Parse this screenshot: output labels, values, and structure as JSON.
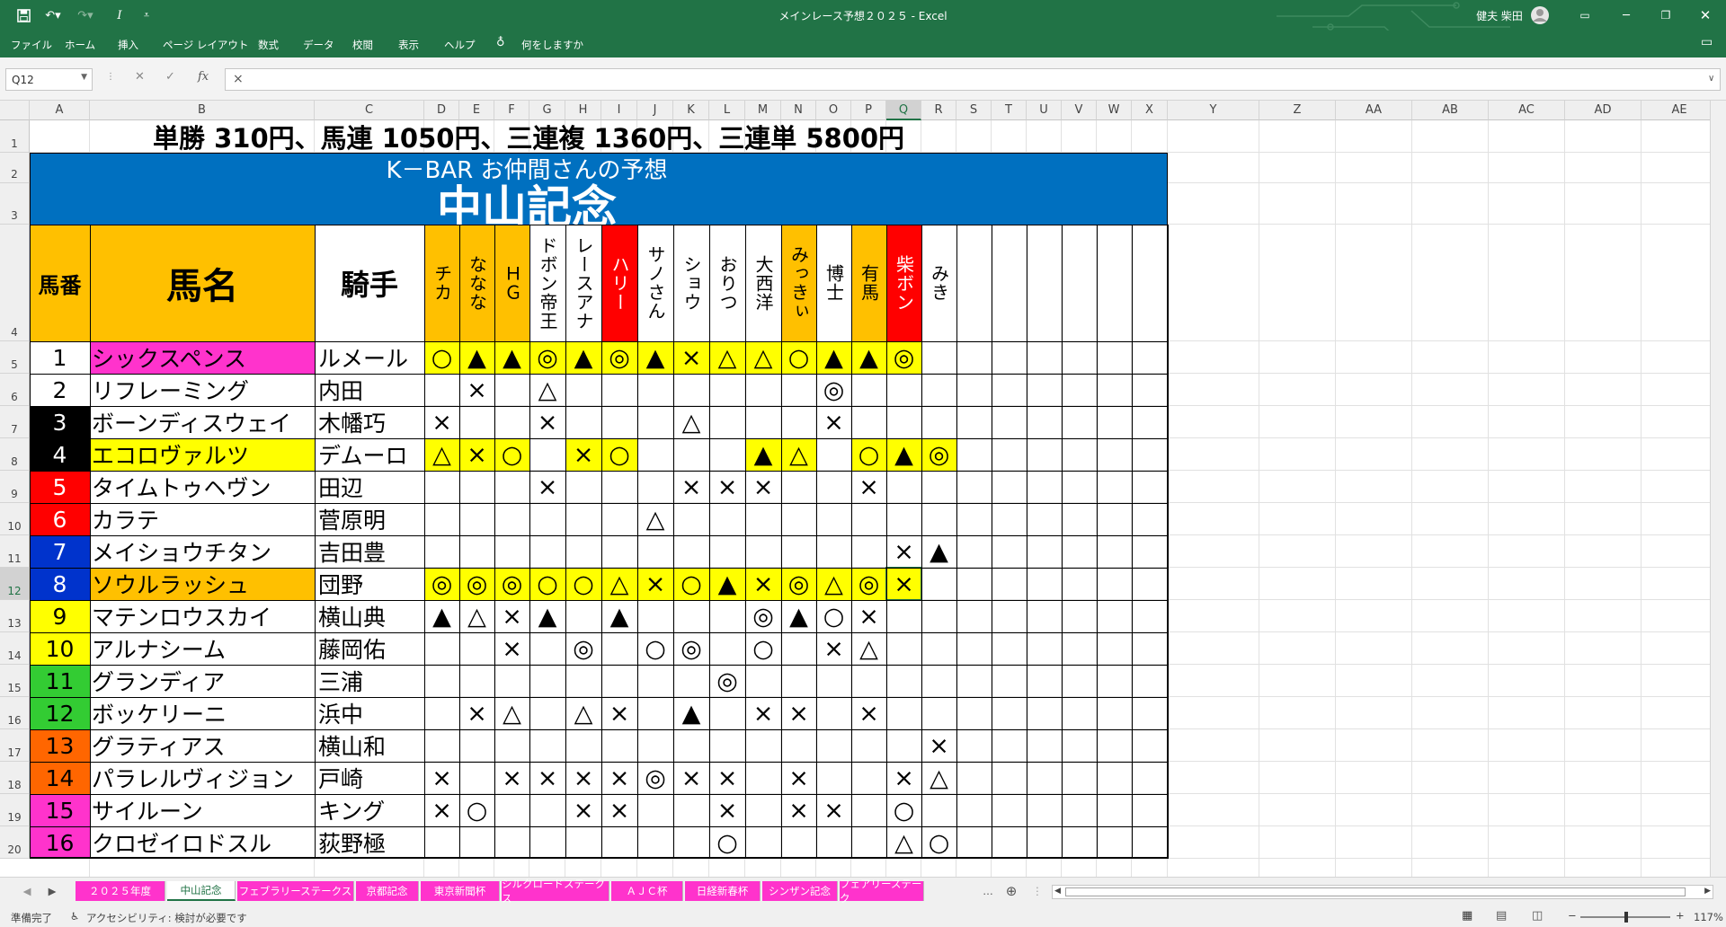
{
  "window": {
    "title": "メインレース予想２０２５ - Excel",
    "user": "健夫 柴田"
  },
  "ribbon": {
    "tabs": [
      "ファイル",
      "ホーム",
      "挿入",
      "ページ レイアウト",
      "数式",
      "データ",
      "校閲",
      "表示",
      "ヘルプ"
    ],
    "tell_me": "何をしますか"
  },
  "formula_bar": {
    "name_box": "Q12",
    "fx": "fx",
    "content": "×"
  },
  "columns": [
    "A",
    "B",
    "C",
    "D",
    "E",
    "F",
    "G",
    "H",
    "I",
    "J",
    "K",
    "L",
    "M",
    "N",
    "O",
    "P",
    "Q",
    "R",
    "S",
    "T",
    "U",
    "V",
    "W",
    "X",
    "Y",
    "Z",
    "AA",
    "AB",
    "AC",
    "AD",
    "AE"
  ],
  "selected_column": "Q",
  "selected_row": "12",
  "rows": [
    "1",
    "2",
    "3",
    "4",
    "5",
    "6",
    "7",
    "8",
    "9",
    "10",
    "11",
    "12",
    "13",
    "14",
    "15",
    "16",
    "17",
    "18",
    "19",
    "20"
  ],
  "sheet": {
    "payout": "単勝 310円、馬連 1050円、三連複 1360円、三連単 5800円",
    "subtitle": "K－BAR お仲間さんの予想",
    "race": "中山記念",
    "hdr_num": "馬番",
    "hdr_name": "馬名",
    "hdr_jockey": "騎手",
    "predictors": [
      "チカ",
      "ななな",
      "ＨＧ",
      "ドボン帝王",
      "レースアナ",
      "ハリー",
      "サノさん",
      "ショウ",
      "おりつ",
      "大西洋",
      "みっきぃ",
      "博士",
      "有馬",
      "柴ボン",
      "みき"
    ],
    "predictor_colors": [
      "#ffc000",
      "#ffc000",
      "#ffc000",
      "#ffffff",
      "#ffffff",
      "#ff0000",
      "#ffffff",
      "#ffffff",
      "#ffffff",
      "#ffffff",
      "#ffc000",
      "#ffffff",
      "#ffc000",
      "#ff0000",
      "#ffffff"
    ],
    "horses": [
      {
        "num": "1",
        "name": "シックスペンス",
        "jockey": "ルメール",
        "marks": [
          "○",
          "▲",
          "▲",
          "◎",
          "▲",
          "◎",
          "▲",
          "×",
          "△",
          "△",
          "○",
          "▲",
          "▲",
          "◎",
          ""
        ]
      },
      {
        "num": "2",
        "name": "リフレーミング",
        "jockey": "内田",
        "marks": [
          "",
          "×",
          "",
          "△",
          "",
          "",
          "",
          "",
          "",
          "",
          "",
          "◎",
          "",
          "",
          ""
        ]
      },
      {
        "num": "3",
        "name": "ボーンディスウェイ",
        "jockey": "木幡巧",
        "marks": [
          "×",
          "",
          "",
          "×",
          "",
          "",
          "",
          "△",
          "",
          "",
          "",
          "×",
          "",
          "",
          ""
        ]
      },
      {
        "num": "4",
        "name": "エコロヴァルツ",
        "jockey": "デムーロ",
        "marks": [
          "△",
          "×",
          "○",
          "",
          "×",
          "○",
          "",
          "",
          "",
          "▲",
          "△",
          "",
          "○",
          "▲",
          "◎"
        ]
      },
      {
        "num": "5",
        "name": "タイムトゥヘヴン",
        "jockey": "田辺",
        "marks": [
          "",
          "",
          "",
          "×",
          "",
          "",
          "",
          "×",
          "×",
          "×",
          "",
          "",
          "×",
          "",
          ""
        ]
      },
      {
        "num": "6",
        "name": "カラテ",
        "jockey": "菅原明",
        "marks": [
          "",
          "",
          "",
          "",
          "",
          "",
          "△",
          "",
          "",
          "",
          "",
          "",
          "",
          "",
          ""
        ]
      },
      {
        "num": "7",
        "name": "メイショウチタン",
        "jockey": "吉田豊",
        "marks": [
          "",
          "",
          "",
          "",
          "",
          "",
          "",
          "",
          "",
          "",
          "",
          "",
          "",
          "×",
          "▲"
        ]
      },
      {
        "num": "8",
        "name": "ソウルラッシュ",
        "jockey": "団野",
        "marks": [
          "◎",
          "◎",
          "◎",
          "○",
          "○",
          "△",
          "×",
          "○",
          "▲",
          "×",
          "◎",
          "△",
          "◎",
          "×",
          ""
        ]
      },
      {
        "num": "9",
        "name": "マテンロウスカイ",
        "jockey": "横山典",
        "marks": [
          "▲",
          "△",
          "×",
          "▲",
          "",
          "▲",
          "",
          "",
          "",
          "◎",
          "▲",
          "○",
          "×",
          "",
          ""
        ]
      },
      {
        "num": "10",
        "name": "アルナシーム",
        "jockey": "藤岡佑",
        "marks": [
          "",
          "",
          "×",
          "",
          "◎",
          "",
          "○",
          "◎",
          "",
          "○",
          "",
          "×",
          "△",
          "",
          ""
        ]
      },
      {
        "num": "11",
        "name": "グランディア",
        "jockey": "三浦",
        "marks": [
          "",
          "",
          "",
          "",
          "",
          "",
          "",
          "",
          "◎",
          "",
          "",
          "",
          "",
          "",
          ""
        ]
      },
      {
        "num": "12",
        "name": "ボッケリーニ",
        "jockey": "浜中",
        "marks": [
          "",
          "×",
          "△",
          "",
          "△",
          "×",
          "",
          "▲",
          "",
          "×",
          "×",
          "",
          "×",
          "",
          ""
        ]
      },
      {
        "num": "13",
        "name": "グラティアス",
        "jockey": "横山和",
        "marks": [
          "",
          "",
          "",
          "",
          "",
          "",
          "",
          "",
          "",
          "",
          "",
          "",
          "",
          "",
          "×"
        ]
      },
      {
        "num": "14",
        "name": "パラレルヴィジョン",
        "jockey": "戸崎",
        "marks": [
          "×",
          "",
          "×",
          "×",
          "×",
          "×",
          "◎",
          "×",
          "×",
          "",
          "×",
          "",
          "",
          "×",
          "△"
        ]
      },
      {
        "num": "15",
        "name": "サイルーン",
        "jockey": "キング",
        "marks": [
          "×",
          "○",
          "",
          "",
          "×",
          "×",
          "",
          "",
          "×",
          "",
          "×",
          "×",
          "",
          "○",
          ""
        ]
      },
      {
        "num": "16",
        "name": "クロゼイロドスル",
        "jockey": "荻野極",
        "marks": [
          "",
          "",
          "",
          "",
          "",
          "",
          "",
          "",
          "○",
          "",
          "",
          "",
          "",
          "△",
          "○"
        ]
      }
    ]
  },
  "sheet_tabs": [
    "２０２５年度",
    "中山記念",
    "フェブラリーステークス",
    "京都記念",
    "東京新聞杯",
    "シルクロードステークス",
    "ＡＪＣ杯",
    "日経新春杯",
    "シンザン記念",
    "フェアリーステーク"
  ],
  "active_tab": "中山記念",
  "status": {
    "ready": "準備完了",
    "accessibility": "アクセシビリティ: 検討が必要です",
    "zoom": "117%"
  },
  "colors": {
    "excel_green": "#217346",
    "title_blue": "#0070c0",
    "header_orange": "#ffc000",
    "hit_yellow": "#ffff00",
    "pink": "#ff33cc"
  }
}
